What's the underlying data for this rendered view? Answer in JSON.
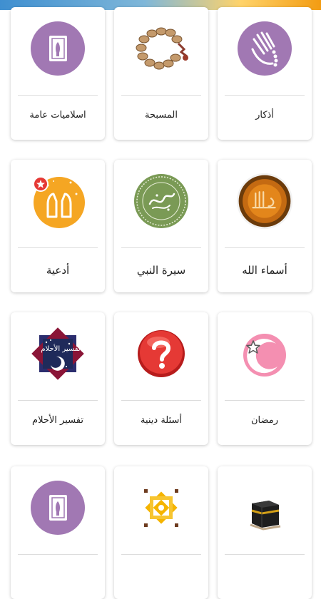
{
  "rows": [
    [
      {
        "label": "اسلاميات عامة",
        "icon": "book-icon"
      },
      {
        "label": "المسبحة",
        "icon": "prayer-beads-icon"
      },
      {
        "label": "أذكار",
        "icon": "counting-hand-icon"
      }
    ],
    [
      {
        "label": "أدعية",
        "icon": "praying-hands-icon"
      },
      {
        "label": "سيرة النبي",
        "icon": "prophet-seal-icon"
      },
      {
        "label": "أسماء الله",
        "icon": "allah-names-icon"
      }
    ],
    [
      {
        "label": "تفسير الأحلام",
        "icon": "dream-interpretation-icon",
        "icon_text": "تفسير الأحلام"
      },
      {
        "label": "أسئلة دينية",
        "icon": "question-mark-icon"
      },
      {
        "label": "رمضان",
        "icon": "crescent-star-icon"
      }
    ],
    [
      {
        "label": "",
        "icon": "book-icon"
      },
      {
        "label": "",
        "icon": "islamic-pattern-icon"
      },
      {
        "label": "",
        "icon": "kaaba-icon"
      }
    ]
  ],
  "colors": {
    "purple": "#a178b3",
    "orange": "#f5a623",
    "green": "#7a9a55",
    "red": "#d9231f",
    "pink": "#f48fb1"
  }
}
